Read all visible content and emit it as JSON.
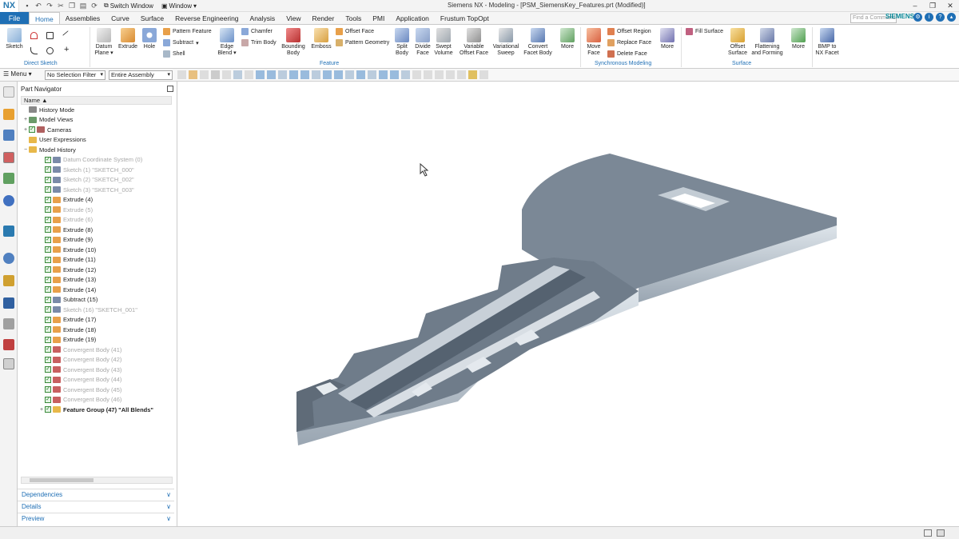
{
  "titlebar": {
    "logo": "NX",
    "switch_window": "Switch Window",
    "window_menu": "Window",
    "title": "Siemens NX - Modeling - [PSM_SiemensKey_Features.prt (Modified)]"
  },
  "menubar": {
    "file": "File",
    "tabs": [
      "Home",
      "Assemblies",
      "Curve",
      "Surface",
      "Reverse Engineering",
      "Analysis",
      "View",
      "Render",
      "Tools",
      "PMI",
      "Application",
      "Frustum TopOpt"
    ],
    "active_tab": "Home",
    "command_search_placeholder": "Find a Command",
    "brand": "SIEMENS"
  },
  "ribbon": {
    "sketch": "Sketch",
    "group_direct_sketch": "Direct Sketch",
    "datum_plane": "Datum Plane",
    "extrude": "Extrude",
    "hole": "Hole",
    "pattern_feature": "Pattern Feature",
    "subtract": "Subtract",
    "shell": "Shell",
    "edge_blend": "Edge Blend",
    "chamfer": "Chamfer",
    "trim_body": "Trim Body",
    "bounding_body": "Bounding Body",
    "emboss": "Emboss",
    "offset_face": "Offset Face",
    "pattern_geometry": "Pattern Geometry",
    "split_body": "Split Body",
    "divide_face": "Divide Face",
    "swept_volume": "Swept Volume",
    "variable_offset_face": "Variable Offset Face",
    "variational_sweep": "Variational Sweep",
    "convert_facet_body": "Convert Facet Body",
    "more1": "More",
    "group_feature": "Feature",
    "move_face": "Move Face",
    "offset_region": "Offset Region",
    "replace_face": "Replace Face",
    "delete_face": "Delete Face",
    "more2": "More",
    "group_sync": "Synchronous Modeling",
    "fill_surface": "Fill Surface",
    "offset_surface": "Offset Surface",
    "flattening_forming": "Flattening and Forming",
    "more3": "More",
    "group_surface": "Surface",
    "bmp_facet": "BMP to NX Facet"
  },
  "selbar": {
    "menu": "Menu",
    "filter": "No Selection Filter",
    "scope": "Entire Assembly"
  },
  "navigator": {
    "title": "Part Navigator",
    "column_name": "Name",
    "rows": [
      {
        "label": "History Mode",
        "indent": 1,
        "exp": "",
        "check": false,
        "state": "normal",
        "icon": "#888888"
      },
      {
        "label": "Model Views",
        "indent": 1,
        "exp": "+",
        "check": false,
        "state": "normal",
        "icon": "#6a9a6a"
      },
      {
        "label": "Cameras",
        "indent": 1,
        "exp": "+",
        "check": true,
        "state": "normal",
        "icon": "#b06060"
      },
      {
        "label": "User Expressions",
        "indent": 1,
        "exp": "",
        "check": false,
        "state": "normal",
        "icon": "#e8b84a"
      },
      {
        "label": "Model History",
        "indent": 1,
        "exp": "−",
        "check": false,
        "state": "normal",
        "icon": "#e8b84a"
      },
      {
        "label": "Datum Coordinate System (0)",
        "indent": 2,
        "exp": "",
        "check": true,
        "state": "grey",
        "icon": "#7a8aa8"
      },
      {
        "label": "Sketch (1) \"SKETCH_000\"",
        "indent": 2,
        "exp": "",
        "check": true,
        "state": "grey",
        "icon": "#7a8aa8"
      },
      {
        "label": "Sketch (2) \"SKETCH_002\"",
        "indent": 2,
        "exp": "",
        "check": true,
        "state": "grey",
        "icon": "#7a8aa8"
      },
      {
        "label": "Sketch (3) \"SKETCH_003\"",
        "indent": 2,
        "exp": "",
        "check": true,
        "state": "grey",
        "icon": "#7a8aa8"
      },
      {
        "label": "Extrude (4)",
        "indent": 2,
        "exp": "",
        "check": true,
        "state": "normal",
        "icon": "#e8a04a"
      },
      {
        "label": "Extrude (5)",
        "indent": 2,
        "exp": "",
        "check": true,
        "state": "grey",
        "icon": "#e8a04a"
      },
      {
        "label": "Extrude (6)",
        "indent": 2,
        "exp": "",
        "check": true,
        "state": "grey",
        "icon": "#e8a04a"
      },
      {
        "label": "Extrude (8)",
        "indent": 2,
        "exp": "",
        "check": true,
        "state": "normal",
        "icon": "#e8a04a"
      },
      {
        "label": "Extrude (9)",
        "indent": 2,
        "exp": "",
        "check": true,
        "state": "normal",
        "icon": "#e8a04a"
      },
      {
        "label": "Extrude (10)",
        "indent": 2,
        "exp": "",
        "check": true,
        "state": "normal",
        "icon": "#e8a04a"
      },
      {
        "label": "Extrude (11)",
        "indent": 2,
        "exp": "",
        "check": true,
        "state": "normal",
        "icon": "#e8a04a"
      },
      {
        "label": "Extrude (12)",
        "indent": 2,
        "exp": "",
        "check": true,
        "state": "normal",
        "icon": "#e8a04a"
      },
      {
        "label": "Extrude (13)",
        "indent": 2,
        "exp": "",
        "check": true,
        "state": "normal",
        "icon": "#e8a04a"
      },
      {
        "label": "Extrude (14)",
        "indent": 2,
        "exp": "",
        "check": true,
        "state": "normal",
        "icon": "#e8a04a"
      },
      {
        "label": "Subtract (15)",
        "indent": 2,
        "exp": "",
        "check": true,
        "state": "normal",
        "icon": "#7a8aa8"
      },
      {
        "label": "Sketch (16) \"SKETCH_001\"",
        "indent": 2,
        "exp": "",
        "check": true,
        "state": "grey",
        "icon": "#7a8aa8"
      },
      {
        "label": "Extrude (17)",
        "indent": 2,
        "exp": "",
        "check": true,
        "state": "normal",
        "icon": "#e8a04a"
      },
      {
        "label": "Extrude (18)",
        "indent": 2,
        "exp": "",
        "check": true,
        "state": "normal",
        "icon": "#e8a04a"
      },
      {
        "label": "Extrude (19)",
        "indent": 2,
        "exp": "",
        "check": true,
        "state": "normal",
        "icon": "#e8a04a"
      },
      {
        "label": "Convergent Body (41)",
        "indent": 2,
        "exp": "",
        "check": true,
        "state": "grey",
        "icon": "#c86060"
      },
      {
        "label": "Convergent Body (42)",
        "indent": 2,
        "exp": "",
        "check": true,
        "state": "grey",
        "icon": "#c86060"
      },
      {
        "label": "Convergent Body (43)",
        "indent": 2,
        "exp": "",
        "check": true,
        "state": "grey",
        "icon": "#c86060"
      },
      {
        "label": "Convergent Body (44)",
        "indent": 2,
        "exp": "",
        "check": true,
        "state": "grey",
        "icon": "#c86060"
      },
      {
        "label": "Convergent Body (45)",
        "indent": 2,
        "exp": "",
        "check": true,
        "state": "grey",
        "icon": "#c86060"
      },
      {
        "label": "Convergent Body (46)",
        "indent": 2,
        "exp": "",
        "check": true,
        "state": "grey",
        "icon": "#c86060"
      },
      {
        "label": "Feature Group (47) \"All Blends\"",
        "indent": 2,
        "exp": "+",
        "check": true,
        "state": "bold",
        "icon": "#e8b84a"
      }
    ],
    "panels": [
      "Dependencies",
      "Details",
      "Preview"
    ]
  },
  "colors": {
    "accent": "#1f6fb5",
    "key_top": "#7b8896",
    "key_side": "#c0c9d1",
    "key_shadow": "#5a6470"
  }
}
